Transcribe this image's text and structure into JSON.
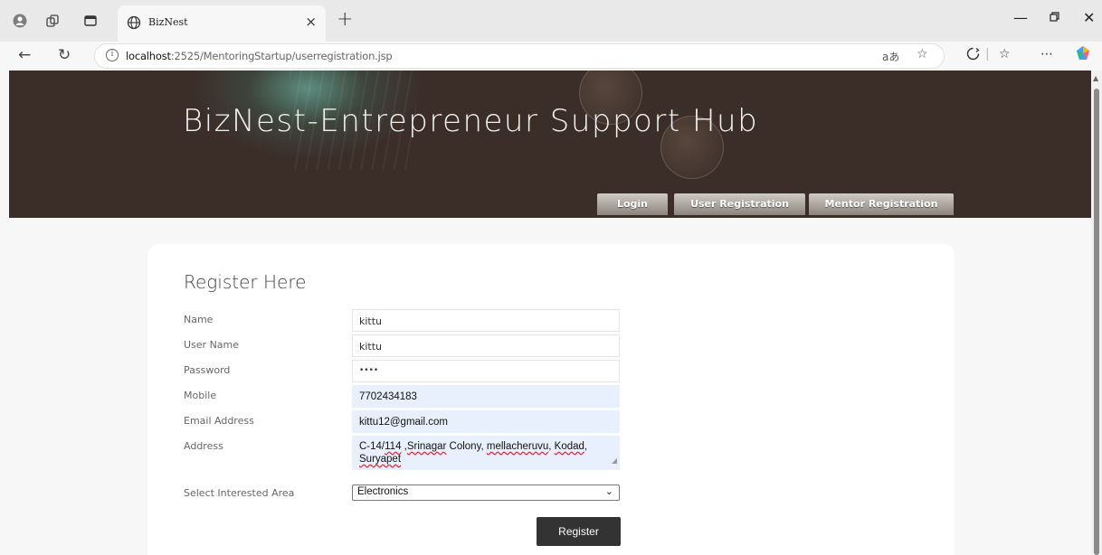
{
  "browser": {
    "tab_title": "BizNest",
    "tab_close": "×",
    "new_tab": "+",
    "url_host": "localhost",
    "url_rest": ":2525/MentoringStartup/userregistration.jsp",
    "read_aloud": "aあ"
  },
  "site": {
    "title": "BizNest-Entrepreneur Support Hub",
    "nav": [
      "Login",
      "User Registration",
      "Mentor Registration"
    ]
  },
  "form": {
    "heading": "Register Here",
    "fields": [
      {
        "label": "Name",
        "value": "kittu"
      },
      {
        "label": "User Name",
        "value": "kittu"
      },
      {
        "label": "Password",
        "value": "••••"
      },
      {
        "label": "Mobile",
        "value": "7702434183"
      },
      {
        "label": "Email Address",
        "value": "kittu12@gmail.com"
      }
    ],
    "address_label": "Address",
    "address_parts": [
      "C-14/",
      "114",
      " ,",
      "Srinagar",
      " Colony, ",
      "mellacheruvu",
      ", ",
      "Kodad",
      ",",
      "Suryapet"
    ],
    "area_label": "Select Interested Area",
    "area_value": "Electronics",
    "submit_label": "Register"
  },
  "colors": {
    "banner": "#3b2d28",
    "button": "#333333",
    "autofill": "#e8f0fe"
  }
}
